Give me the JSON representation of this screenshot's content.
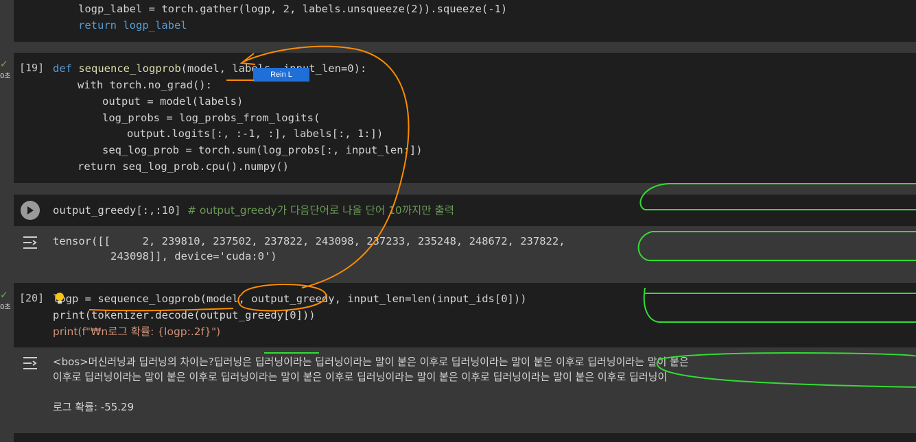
{
  "cells": {
    "prev": {
      "lines": [
        "logp_label = torch.gather(logp, 2, labels.unsqueeze(2)).squeeze(-1)",
        "return logp_label"
      ]
    },
    "c19": {
      "exec_count": "[19]",
      "status_check": "✓",
      "status_time": "0초",
      "line1_def": "def",
      "line1_fn": "sequence_logprob",
      "line1_args": "(model, labels, input_len=0):",
      "line2": "with torch.no_grad():",
      "line3": "output = model(labels)",
      "line4": "log_probs = log_probs_from_logits(",
      "line5": "output.logits[:, :-1, :], labels[:, 1:])",
      "line6": "seq_log_prob = torch.sum(log_probs[:, input_len:])",
      "line7": "return seq_log_prob.cpu().numpy()"
    },
    "cgreedy": {
      "code": "output_greedy[:,:10]",
      "comment": "# output_greedy가 다음단어로 나올 단어 10까지만 출력",
      "out1": "tensor([[     2, 239810, 237502, 237822, 243098, 237233, 235248, 248672, 237822,",
      "out2": "         243098]], device='cuda:0')"
    },
    "c20": {
      "exec_count": "[20]",
      "status_check": "✓",
      "status_time": "0초",
      "line1": "logp = sequence_logprob(model, output_greedy, input_len=len(input_ids[0]))",
      "line2": "print(tokenizer.decode(output_greedy[0]))",
      "line3": "print(f\"₩n로그 확률: {logp:.2f}\")",
      "out1": "<bos>머신러닝과 딥러닝의 차이는?딥러닝은 딥러닝이라는 딥러닝이라는 말이 붙은 이후로 딥러닝이라는 말이 붙은 이후로 딥러닝이라는 말이 붙은",
      "out2": "이후로 딥러닝이라는 말이 붙은 이후로 딥러닝이라는 말이 붙은 이후로 딥러닝이라는 말이 붙은 이후로 딥러닝이라는 말이 붙은 이후로 딥러닝이",
      "out3": "로그 확률: -55.29"
    }
  },
  "tooltip": {
    "label": "Rein L"
  },
  "colors": {
    "cell_bg": "#1e1e1e",
    "page_bg": "#383838",
    "annotation_orange": "#ff8c00",
    "annotation_green": "#33dd33"
  },
  "icons": {
    "run": "play-icon",
    "output": "output-toggle-icon"
  }
}
